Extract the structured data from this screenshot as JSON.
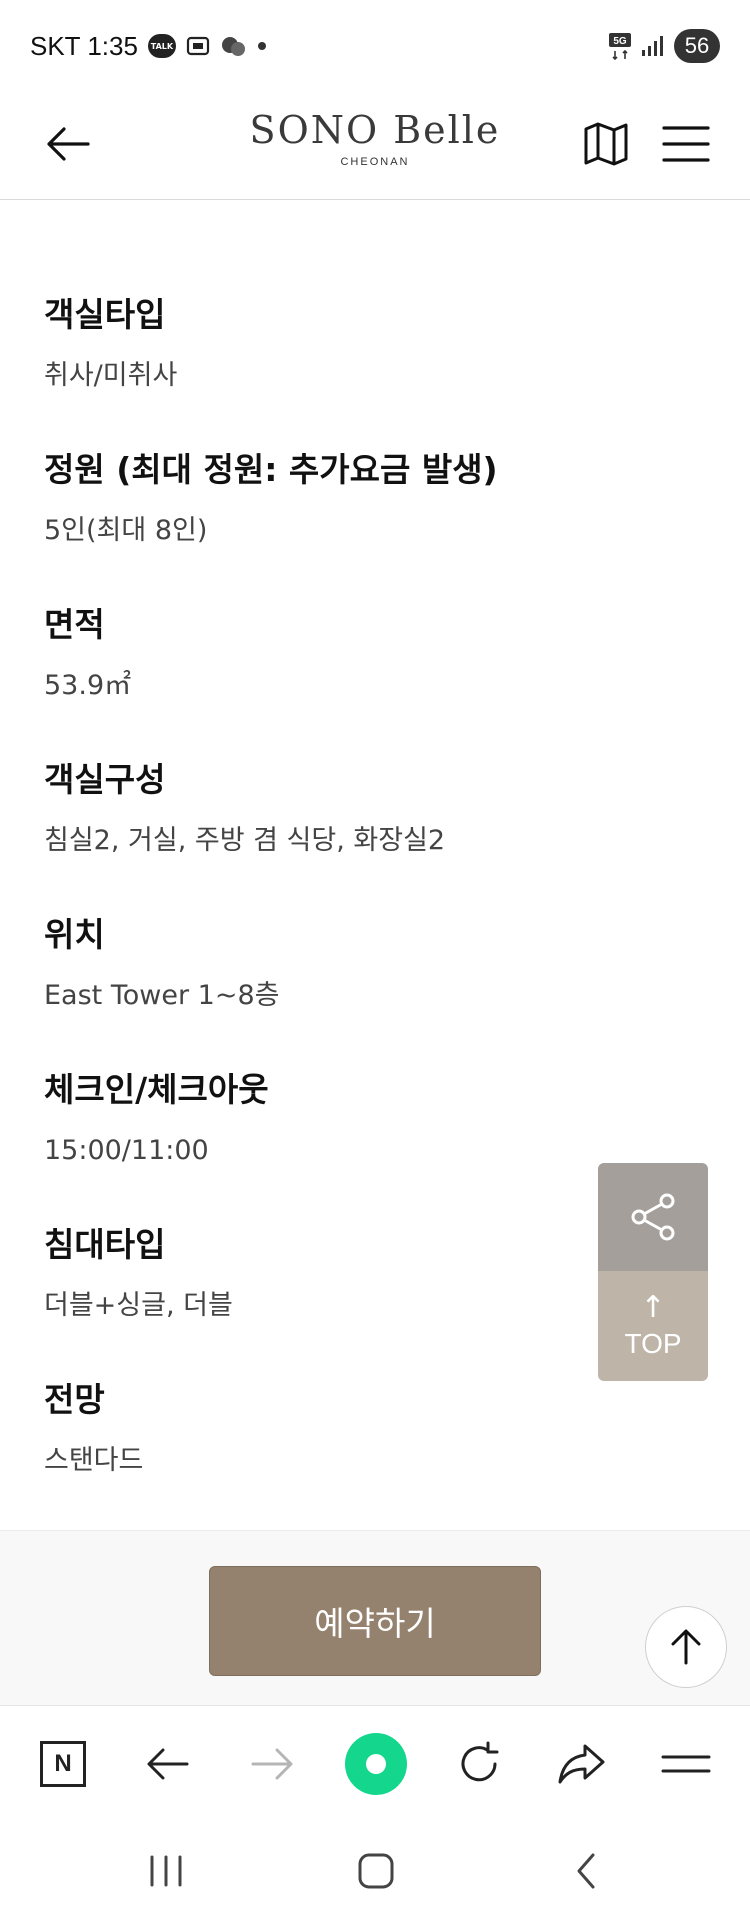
{
  "status_bar": {
    "time": "SKT 1:35",
    "talk_badge": "TALK",
    "network": "5G",
    "battery": "56"
  },
  "header": {
    "logo_main": "SONO Belle",
    "logo_sub": "CHEONAN"
  },
  "room_info": [
    {
      "label": "객실타입",
      "value": "취사/미취사"
    },
    {
      "label": "정원 (최대 정원: 추가요금 발생)",
      "value": "5인(최대 8인)"
    },
    {
      "label": "면적",
      "value": "53.9㎡"
    },
    {
      "label": "객실구성",
      "value": "침실2, 거실, 주방 겸 식당, 화장실2"
    },
    {
      "label": "위치",
      "value": "East Tower 1~8층"
    },
    {
      "label": "체크인/체크아웃",
      "value": "15:00/11:00"
    },
    {
      "label": "침대타입",
      "value": "더블+싱글, 더블"
    },
    {
      "label": "전망",
      "value": "스탠다드"
    }
  ],
  "floating": {
    "top_label": "TOP",
    "top_arrow": "↑"
  },
  "reserve": {
    "button_label": "예약하기"
  },
  "browser_toolbar": {
    "n_label": "N"
  },
  "colors": {
    "reserve_button": "#94826e",
    "naver_green": "#14d68c",
    "share_bg": "#8a847e",
    "top_bg": "#aca090"
  }
}
